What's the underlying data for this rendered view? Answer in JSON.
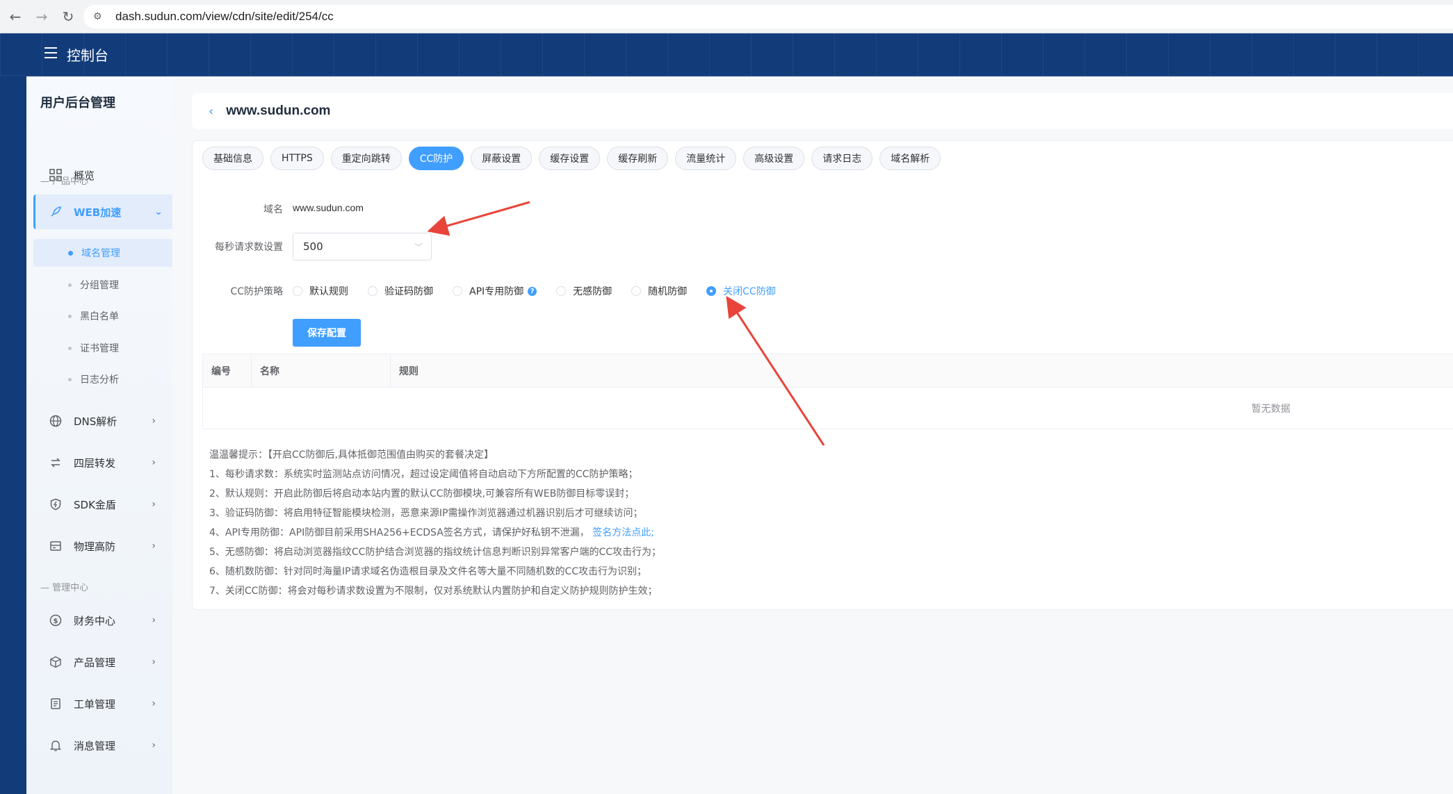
{
  "browser": {
    "url": "dash.sudun.com/view/cdn/site/edit/254/cc"
  },
  "header": {
    "title": "控制台"
  },
  "sidebar": {
    "title": "用户后台管理",
    "overview": "概览",
    "section_product": "产品中心",
    "web": "WEB加速",
    "sub": [
      "域名管理",
      "分组管理",
      "黑白名单",
      "证书管理",
      "日志分析"
    ],
    "dns": "DNS解析",
    "l4": "四层转发",
    "sdk": "SDK金盾",
    "physical": "物理高防",
    "section_manage": "管理中心",
    "finance": "财务中心",
    "product_manage": "产品管理",
    "ticket": "工单管理",
    "message": "消息管理"
  },
  "site": {
    "name": "www.sudun.com"
  },
  "tabs": [
    "基础信息",
    "HTTPS",
    "重定向跳转",
    "CC防护",
    "屏蔽设置",
    "缓存设置",
    "缓存刷新",
    "流量统计",
    "高级设置",
    "请求日志",
    "域名解析"
  ],
  "form": {
    "domain_label": "域名",
    "domain_value": "www.sudun.com",
    "rps_label": "每秒请求数设置",
    "rps_value": "500",
    "policy_label": "CC防护策略",
    "policies": [
      "默认规则",
      "验证码防御",
      "API专用防御",
      "无感防御",
      "随机防御",
      "关闭CC防御"
    ],
    "selected_policy": "关闭CC防御",
    "save": "保存配置"
  },
  "table": {
    "columns": [
      "编号",
      "名称",
      "规则"
    ],
    "empty": "暂无数据"
  },
  "tips": {
    "title": "温温馨提示：【开启CC防御后,具体抵御范围值由购买的套餐决定】",
    "line1": "1、每秒请求数：系统实时监测站点访问情况，超过设定阈值将自动启动下方所配置的CC防护策略；",
    "line2": "2、默认规则：开启此防御后将启动本站内置的默认CC防御模块,可兼容所有WEB防御目标零误封；",
    "line3": "3、验证码防御：将启用特征智能模块检测，恶意来源IP需操作浏览器通过机器识别后才可继续访问；",
    "line4": "4、API专用防御：API防御目前采用SHA256+ECDSA签名方式，请保护好私钥不泄漏，",
    "line4_link": "签名方法点此;",
    "line5": "5、无感防御：将启动浏览器指纹CC防护结合浏览器的指纹统计信息判断识别异常客户端的CC攻击行为；",
    "line6": "6、随机数防御：针对同时海量IP请求域名伪造根目录及文件名等大量不同随机数的CC攻击行为识别；",
    "line7": "7、关闭CC防御：将会对每秒请求数设置为不限制，仅对系统默认内置防护和自定义防护规则防护生效；"
  },
  "colors": {
    "accent": "#409eff",
    "header_bg": "#123b7a",
    "annotation": "#e8443a"
  }
}
